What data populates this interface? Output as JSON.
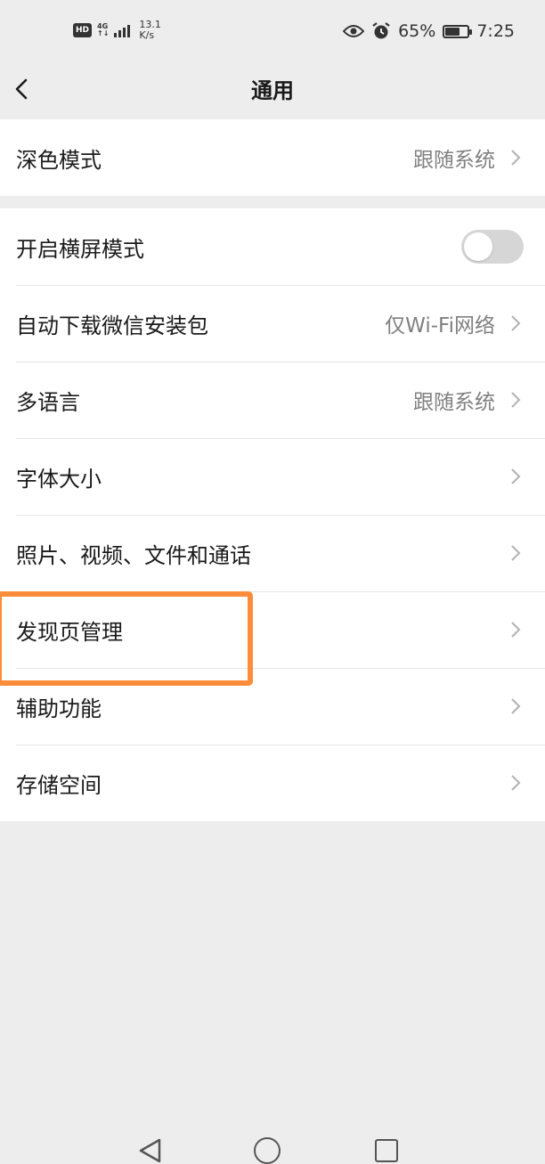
{
  "status_bar": {
    "hd": "HD",
    "network": "4G",
    "network_sub": "↑↓",
    "speed_value": "13.1",
    "speed_unit": "K/s",
    "battery_percent": "65%",
    "battery_level": 0.65,
    "time": "7:25",
    "icons": [
      "eye-icon",
      "alarm-icon",
      "battery-icon"
    ]
  },
  "header": {
    "title": "通用",
    "back_icon": "chevron-left-icon"
  },
  "group1": {
    "items": [
      {
        "label": "深色模式",
        "value": "跟随系统"
      }
    ]
  },
  "group2": {
    "items": [
      {
        "label": "开启横屏模式",
        "toggle": false
      },
      {
        "label": "自动下载微信安装包",
        "value": "仅Wi-Fi网络"
      },
      {
        "label": "多语言",
        "value": "跟随系统"
      },
      {
        "label": "字体大小",
        "value": ""
      },
      {
        "label": "照片、视频、文件和通话",
        "value": ""
      },
      {
        "label": "发现页管理",
        "value": ""
      },
      {
        "label": "辅助功能",
        "value": ""
      },
      {
        "label": "存储空间",
        "value": ""
      }
    ]
  },
  "highlight_color": "#ff8c3a",
  "nav_bar": {
    "icons": [
      "nav-back-icon",
      "nav-home-icon",
      "nav-recent-icon"
    ]
  }
}
